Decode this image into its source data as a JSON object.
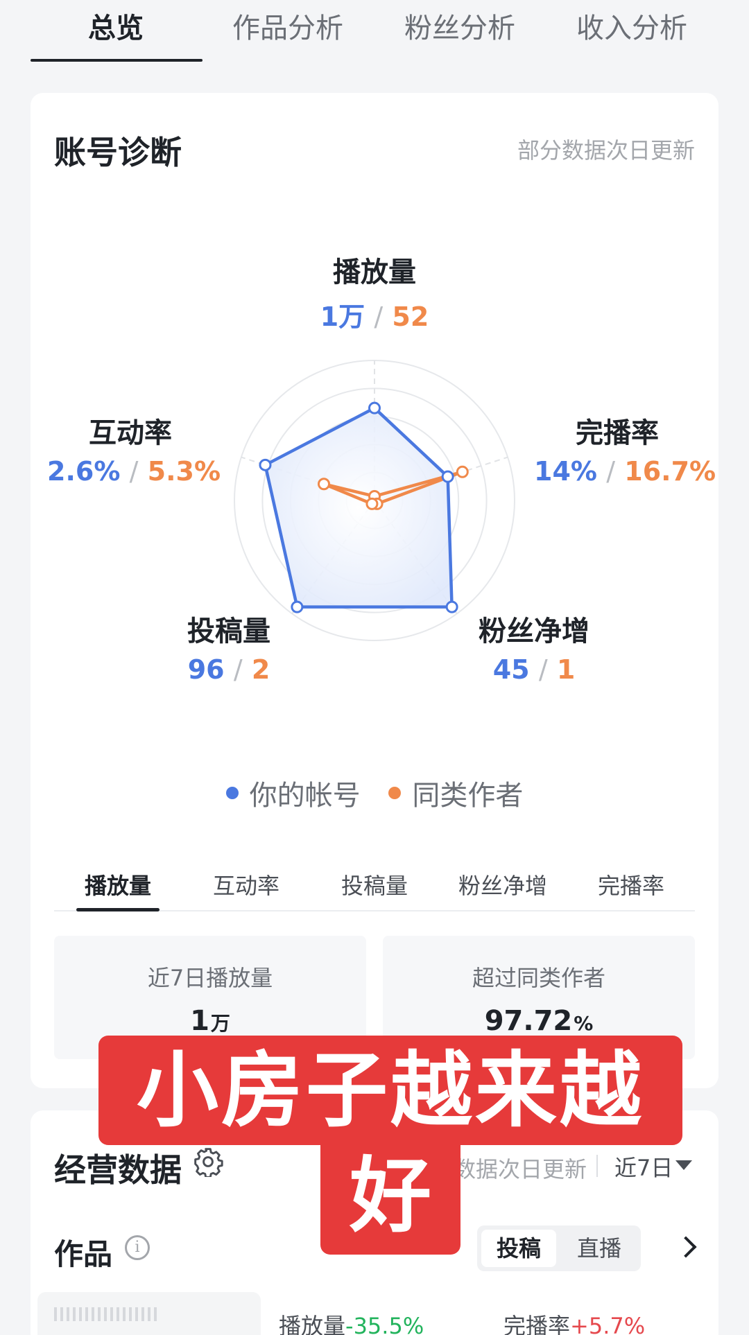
{
  "top_tabs": [
    {
      "label": "总览",
      "active": true
    },
    {
      "label": "作品分析",
      "active": false
    },
    {
      "label": "粉丝分析",
      "active": false
    },
    {
      "label": "收入分析",
      "active": false
    }
  ],
  "diagnosis": {
    "title": "账号诊断",
    "note": "部分数据次日更新",
    "radar": {
      "axes": [
        {
          "name": "播放量",
          "yours": "1万",
          "peers": "52"
        },
        {
          "name": "完播率",
          "yours": "14%",
          "peers": "16.7%"
        },
        {
          "name": "粉丝净增",
          "yours": "45",
          "peers": "1"
        },
        {
          "name": "投稿量",
          "yours": "96",
          "peers": "2"
        },
        {
          "name": "互动率",
          "yours": "2.6%",
          "peers": "5.3%"
        }
      ],
      "separator": "/",
      "yours_levels": [
        0.66,
        0.55,
        0.94,
        0.94,
        0.82
      ],
      "peers_levels": [
        0.03,
        0.66,
        0.03,
        0.03,
        0.38
      ],
      "colors": {
        "yours": "#4a78e0",
        "peers": "#f0894a"
      }
    },
    "legend": {
      "yours": "你的帐号",
      "peers": "同类作者"
    },
    "metric_tabs": [
      "播放量",
      "互动率",
      "投稿量",
      "粉丝净增",
      "完播率"
    ],
    "active_metric": "播放量",
    "stats": [
      {
        "label": "近7日播放量",
        "value": "1",
        "unit": "万"
      },
      {
        "label": "超过同类作者",
        "value": "97.72",
        "unit": "%"
      }
    ]
  },
  "business": {
    "title": "经营数据",
    "note": "数据次日更新",
    "range": "近7日",
    "works_title": "作品",
    "segments": [
      "投稿",
      "直播"
    ],
    "active_segment": "投稿",
    "trends": [
      {
        "label": "播放量",
        "value": "-35.5%",
        "direction": "down"
      },
      {
        "label": "完播率",
        "value": "+5.7%",
        "direction": "up"
      }
    ]
  },
  "overlay": {
    "line1": "小房子越来越",
    "line2": "好"
  }
}
